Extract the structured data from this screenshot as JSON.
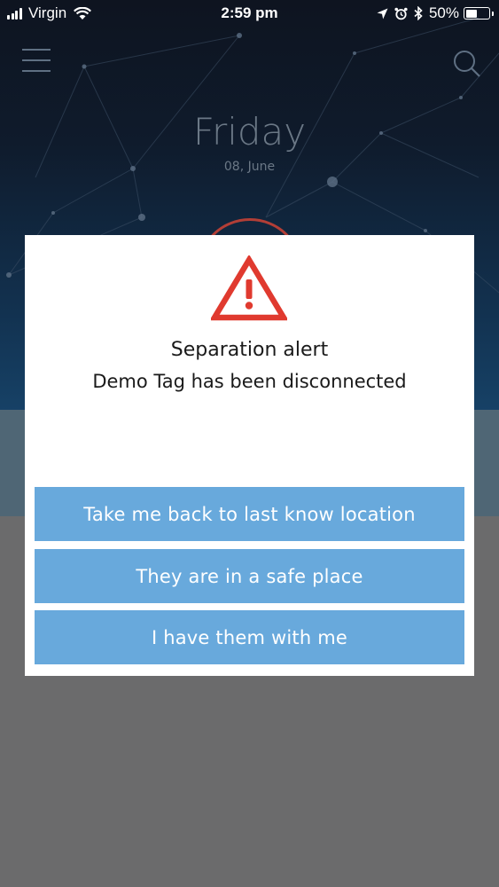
{
  "status_bar": {
    "carrier": "Virgin",
    "time": "2:59 pm",
    "battery_percent": "50%",
    "battery_level": 0.5,
    "icons": [
      "signal-icon",
      "wifi-icon",
      "location-arrow-icon",
      "alarm-icon",
      "bluetooth-icon",
      "battery-icon"
    ]
  },
  "header": {
    "menu_icon": "hamburger-menu-icon",
    "search_icon": "search-icon",
    "day": "Friday",
    "date": "08, June"
  },
  "alert": {
    "icon": "warning-triangle-icon",
    "title": "Separation alert",
    "message": "Demo Tag has been disconnected",
    "actions": [
      "Take me back to last know location",
      "They are in a safe place",
      "I have them with me"
    ]
  },
  "colors": {
    "accent_button": "#68a9dc",
    "warning_red": "#e03a2f",
    "hero_dark": "#0e1420",
    "overlay_grey": "#6b6b6c"
  }
}
